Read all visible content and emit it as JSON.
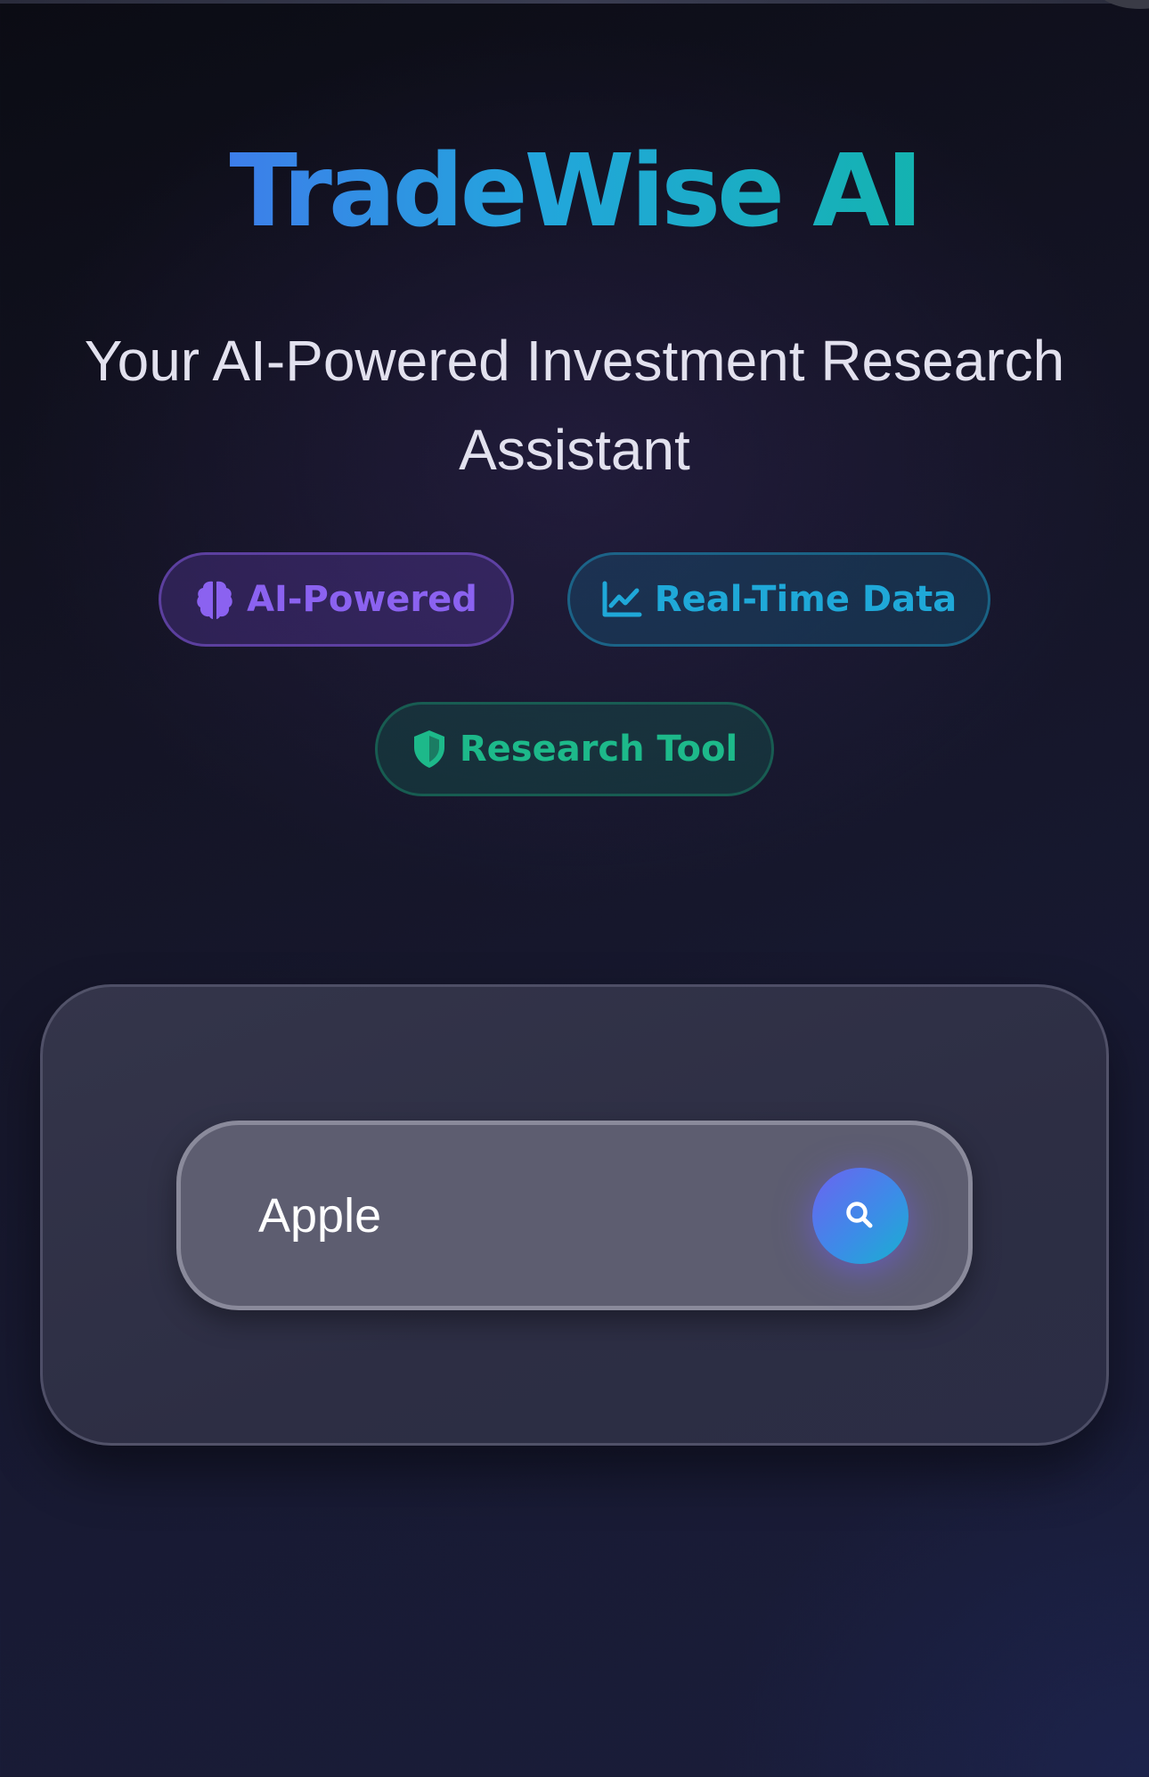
{
  "header": {
    "title": "TradeWise AI",
    "subtitle": "Your AI-Powered Investment Research Assistant"
  },
  "badges": [
    {
      "label": "AI-Powered",
      "icon": "brain-icon",
      "color": "#8b62f0"
    },
    {
      "label": "Real-Time Data",
      "icon": "chart-line-icon",
      "color": "#1fa8d8"
    },
    {
      "label": "Research Tool",
      "icon": "shield-icon",
      "color": "#1db98a"
    }
  ],
  "search": {
    "value": "Apple",
    "button_icon": "search-icon"
  },
  "colors": {
    "title_gradient_start": "#3d7eea",
    "title_gradient_end": "#14b3b0",
    "background": "#141425"
  }
}
